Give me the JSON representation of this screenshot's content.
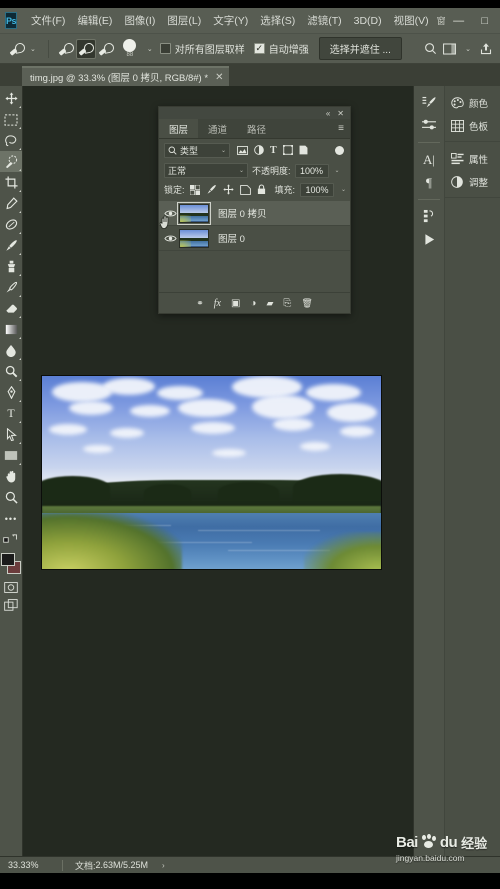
{
  "app": {
    "logo": "Ps",
    "menu_items": [
      "文件(F)",
      "编辑(E)",
      "图像(I)",
      "图层(L)",
      "文字(Y)",
      "选择(S)",
      "滤镜(T)",
      "3D(D)",
      "视图(V)"
    ],
    "menu_overflow": "窗",
    "window_buttons": {
      "minimize": "—",
      "maximize": "□",
      "close": "✕"
    }
  },
  "options_bar": {
    "tool_preset_caret": "⌄",
    "modes": [
      "new-selection",
      "add-to-selection",
      "subtract-from-selection"
    ],
    "brush_size": "88",
    "brush_caret": "⌄",
    "sample_all_layers_label": "对所有图层取样",
    "sample_all_layers_checked": false,
    "auto_enhance_label": "自动增强",
    "auto_enhance_checked": true,
    "select_and_mask_label": "选择并遮住 ...",
    "search_icon": "search-icon",
    "workspace_icon": "workspace-icon",
    "workspace_caret": "⌄",
    "share_icon": "share-icon"
  },
  "document_tab": {
    "label": "timg.jpg @ 33.3% (图层 0 拷贝, RGB/8#) *",
    "close": "✕"
  },
  "toolbar": {
    "tools": [
      {
        "name": "move-tool",
        "glyph": "✥",
        "active": false
      },
      {
        "name": "rectangular-marquee-tool",
        "glyph": "▭",
        "active": false
      },
      {
        "name": "lasso-tool",
        "glyph": "⌁",
        "active": false
      },
      {
        "name": "quick-selection-tool",
        "glyph": "brush",
        "active": true
      },
      {
        "name": "crop-tool",
        "glyph": "⌗",
        "active": false
      },
      {
        "name": "eyedropper-tool",
        "glyph": "⌾",
        "active": false
      },
      {
        "name": "healing-brush-tool",
        "glyph": "◑",
        "active": false
      },
      {
        "name": "brush-tool",
        "glyph": "brush",
        "active": false
      },
      {
        "name": "clone-stamp-tool",
        "glyph": "⚑",
        "active": false
      },
      {
        "name": "history-brush-tool",
        "glyph": "⌇",
        "active": false
      },
      {
        "name": "eraser-tool",
        "glyph": "◧",
        "active": false
      },
      {
        "name": "gradient-tool",
        "glyph": "▤",
        "active": false
      },
      {
        "name": "blur-tool",
        "glyph": "◒",
        "active": false
      },
      {
        "name": "dodge-tool",
        "glyph": "◯",
        "active": false
      },
      {
        "name": "pen-tool",
        "glyph": "✒",
        "active": false
      },
      {
        "name": "horizontal-type-tool",
        "glyph": "T",
        "active": false
      },
      {
        "name": "path-selection-tool",
        "glyph": "➤",
        "active": false
      },
      {
        "name": "rectangle-tool",
        "glyph": "▬",
        "active": false
      },
      {
        "name": "hand-tool",
        "glyph": "✋",
        "active": false
      },
      {
        "name": "zoom-tool",
        "glyph": "⌕",
        "active": false
      }
    ],
    "more_tools": "•••",
    "foreground_color": "#1b1b1b",
    "background_color": "#6b3c3c",
    "quick_mask": "quick-mask-icon",
    "screen_mode": "screen-mode-icon"
  },
  "layers_panel": {
    "collapse": "«",
    "close": "✕",
    "menu": "≡",
    "tabs": [
      {
        "label": "图层",
        "active": true
      },
      {
        "label": "通道",
        "active": false
      },
      {
        "label": "路径",
        "active": false
      }
    ],
    "filter": {
      "search_icon": "search-icon",
      "kind_label": "类型",
      "caret": "⌄",
      "icons": [
        "pixel-filter-icon",
        "adjustment-filter-icon",
        "type-filter-icon",
        "shape-filter-icon",
        "smart-object-filter-icon"
      ],
      "toggle": "filter-enable-toggle"
    },
    "blend_mode": "正常",
    "blend_caret": "⌄",
    "opacity_label": "不透明度:",
    "opacity_value": "100%",
    "lock_label": "锁定:",
    "lock_icons": [
      "lock-transparency-icon",
      "lock-image-icon",
      "lock-position-icon",
      "lock-artboard-icon",
      "lock-all-icon"
    ],
    "fill_label": "填充:",
    "fill_value": "100%",
    "layers": [
      {
        "name": "图层 0 拷贝",
        "visible": true,
        "selected": true
      },
      {
        "name": "图层 0",
        "visible": true,
        "selected": false
      }
    ],
    "bottom_buttons": [
      {
        "name": "link-layers-button",
        "glyph": "⚭"
      },
      {
        "name": "layer-style-button",
        "glyph": "fx"
      },
      {
        "name": "add-layer-mask-button",
        "glyph": "▣"
      },
      {
        "name": "new-adjustment-layer-button",
        "glyph": "◑"
      },
      {
        "name": "new-group-button",
        "glyph": "▰"
      },
      {
        "name": "new-layer-button",
        "glyph": "⎘"
      },
      {
        "name": "delete-layer-button",
        "glyph": "🗑"
      }
    ]
  },
  "right_dock": {
    "rail_icons": [
      {
        "name": "brush-settings-icon",
        "glyph": "✎"
      },
      {
        "name": "brush-presets-icon",
        "glyph": "⚙"
      },
      {
        "name": "character-panel-icon",
        "glyph": "A"
      },
      {
        "name": "paragraph-panel-icon",
        "glyph": "¶"
      },
      {
        "name": "history-panel-icon",
        "glyph": "↺"
      },
      {
        "name": "actions-panel-icon",
        "glyph": "▶"
      }
    ],
    "panels": [
      {
        "label": "颜色",
        "icon": "color-palette-icon",
        "glyph": "◕"
      },
      {
        "label": "色板",
        "icon": "swatches-grid-icon",
        "glyph": "▦"
      },
      {
        "label": "属性",
        "icon": "properties-icon",
        "glyph": "▤"
      },
      {
        "label": "调整",
        "icon": "adjustments-icon",
        "glyph": "◑"
      }
    ]
  },
  "status_bar": {
    "zoom": "33.33%",
    "doc_label": "文档:",
    "doc_size": "2.63M/5.25M",
    "arrow": "›"
  },
  "watermark": {
    "brand": "Bai",
    "brand2": "du",
    "suffix": "经验",
    "url": "jingyan.baidu.com"
  },
  "canvas": {
    "image_name": "lake-landscape-photo",
    "image_description": "蓝天白云下的湖泊风景，前景有绿色芦苇"
  },
  "colors": {
    "menu_bg": "#585d53",
    "panel_bg": "#4a4f45",
    "canvas_bg": "#242921",
    "text": "#dfe2db",
    "selected_row": "#5a5f55"
  }
}
